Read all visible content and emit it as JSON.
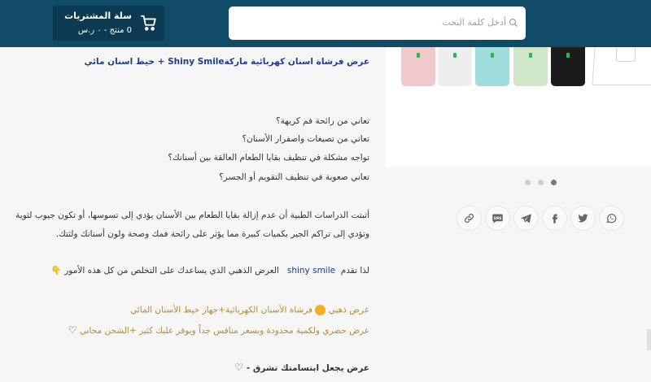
{
  "header": {
    "cart": {
      "title": "سلة المشتريات",
      "summary": "0 منتج - ٠ ر.س",
      "icon": "cart-icon"
    },
    "search": {
      "placeholder": "أدخل كلمة البحث",
      "icon": "search-icon"
    }
  },
  "product": {
    "title": "عرض فرشاة اسنان كهربائية ماركةShiny Smile + خيط اسنان مائي",
    "questions": [
      "تعاني من رائحة فم كريهة؟",
      "تعاني من تصبغات واصفرار الأسنان؟",
      "تواجه مشكلة في تنظيف بقايا الطعام العالقة بين أسنانك؟",
      "تعاني صعوبة في تنظيف التقويم أو الجسر؟"
    ],
    "paragraph": [
      "أثبتت الدراسات الطبية أن عدم إزالة بقايا الطعام بين الأسنان يؤدي إلى تسوسها، أو تكون جيوب لثوية",
      "وتؤدي إلى تراكم الجير بكميات كبيرة مما يؤثر على رائحة فمك وصحة ولون أسنانك ولثتك."
    ],
    "intro_prefix": "لذا تقدم",
    "brand": "shiny smile",
    "intro_suffix": "العرض الذهبي الذي يساعدك على التخلص من كل هذه الأمور",
    "offer_line1_prefix": "عرض ذهبي",
    "offer_line1": "فرشاة الأسنان الكهربائية+جهاز خيط الأسنان المائي",
    "offer_line2": "عرض حصري ولكمية محدودة وبسعر منافس جداً ويوفر عليك كثير +الشحن مجاني",
    "closing": "عرض يجعل ابتسامتك تشرق -",
    "heart": "♡",
    "hand": "👇",
    "colors": {
      "title": "#1f3c88",
      "gold": "#b98b2c",
      "header": "#0f4a66"
    }
  },
  "gallery": {
    "brushes": [
      {
        "color": "#f0c9cc"
      },
      {
        "color": "#eeeeee"
      },
      {
        "color": "#9fdcdc"
      },
      {
        "color": "#cfe7c8"
      },
      {
        "color": "#1b1b1b"
      }
    ],
    "active_slide": 3,
    "slide_count": 3
  },
  "share": [
    "whatsapp-icon",
    "twitter-icon",
    "facebook-icon",
    "telegram-icon",
    "sms-icon",
    "link-icon"
  ]
}
